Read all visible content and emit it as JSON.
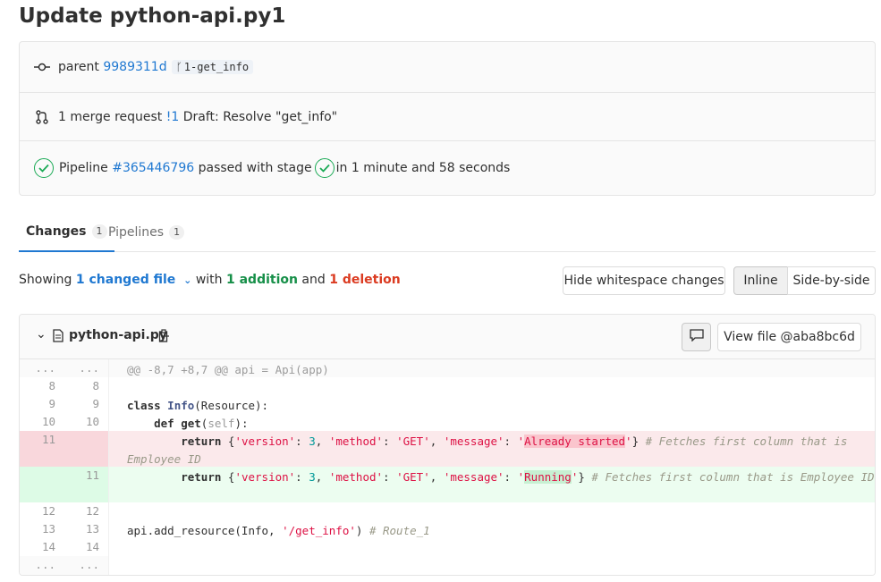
{
  "page": {
    "title": "Update python-api.py1"
  },
  "commit_info": {
    "parent_label": "parent",
    "parent_sha": "9989311d",
    "branch": "1-get_info",
    "mr_text": "1 merge request",
    "mr_ref": "!1",
    "mr_title": "Draft: Resolve \"get_info\"",
    "pipeline_label": "Pipeline",
    "pipeline_ref": "#365446796",
    "pipeline_status": "passed with stage",
    "pipeline_duration": "in 1 minute and 58 seconds"
  },
  "tabs": [
    {
      "label": "Changes",
      "count": "1",
      "active": true
    },
    {
      "label": "Pipelines",
      "count": "1",
      "active": false
    }
  ],
  "stats": {
    "showing": "Showing",
    "changed": "1 changed file",
    "with": "with",
    "additions": "1 addition",
    "and": "and",
    "deletions": "1 deletion"
  },
  "view_buttons": {
    "whitespace": "Hide whitespace changes",
    "inline": "Inline",
    "side_by_side": "Side-by-side"
  },
  "file": {
    "name": "python-api.py",
    "view_file": "View file @aba8bc6d"
  },
  "diff": {
    "hunk_old": "...",
    "hunk_new": "...",
    "hunk_header": "@@ -8,7 +8,7 @@ api = Api(app)",
    "lines": [
      {
        "old": "8",
        "new": "8"
      },
      {
        "old": "9",
        "new": "9"
      },
      {
        "old": "10",
        "new": "10"
      },
      {
        "old": "11",
        "new": "",
        "marker": "-"
      },
      {
        "old": "",
        "new": "11",
        "marker": "+"
      },
      {
        "old": "12",
        "new": "12"
      },
      {
        "old": "13",
        "new": "13"
      },
      {
        "old": "14",
        "new": "14"
      }
    ],
    "code": {
      "l9_kw": "class",
      "l9_cls": "Info",
      "l9_rest": "(Resource):",
      "l10_indent": "    ",
      "l10_kw": "def",
      "l10_fn": "get",
      "l10_open": "(",
      "l10_self": "self",
      "l10_close": "):",
      "ret": "return",
      "s_version": "'version'",
      "n_3": "3",
      "s_method": "'method'",
      "s_get": "'GET'",
      "s_message": "'message'",
      "del_q1": "'",
      "del_val": "Already started",
      "del_q2": "'",
      "add_q1": "'",
      "add_val": "Running",
      "add_q2": "'",
      "comment": "# Fetches first column that is Employee ID",
      "l13_pre": "api.add_resource(Info, ",
      "l13_str": "'/get_info'",
      "l13_post": ") ",
      "l13_cmt": "# Route_1"
    },
    "footer_old": "...",
    "footer_new": "..."
  },
  "colors": {
    "link": "#1f78d1",
    "success": "#1aaa55",
    "addition": "#168f48",
    "deletion": "#db3b21"
  }
}
